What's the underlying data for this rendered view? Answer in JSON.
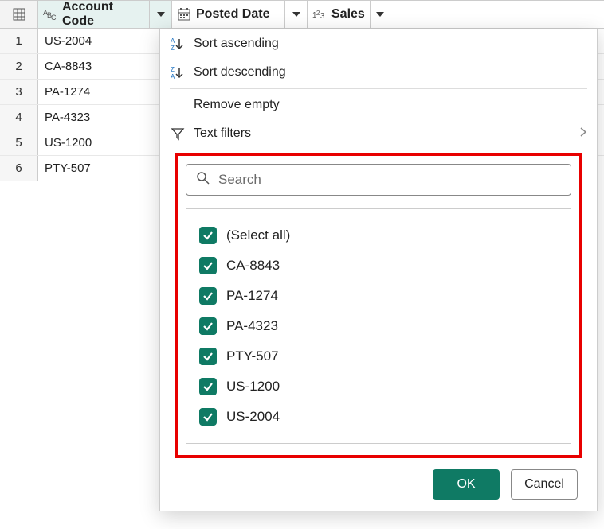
{
  "columns": [
    {
      "label": "Account Code",
      "type_icon": "text"
    },
    {
      "label": "Posted Date",
      "type_icon": "date"
    },
    {
      "label": "Sales",
      "type_icon": "number"
    }
  ],
  "rows": [
    {
      "n": "1",
      "c1": "US-2004"
    },
    {
      "n": "2",
      "c1": "CA-8843"
    },
    {
      "n": "3",
      "c1": "PA-1274"
    },
    {
      "n": "4",
      "c1": "PA-4323"
    },
    {
      "n": "5",
      "c1": "US-1200"
    },
    {
      "n": "6",
      "c1": "PTY-507"
    }
  ],
  "menu": {
    "sort_asc": "Sort ascending",
    "sort_desc": "Sort descending",
    "remove_empty": "Remove empty",
    "text_filters": "Text filters"
  },
  "search": {
    "placeholder": "Search"
  },
  "filter_options": [
    "(Select all)",
    "CA-8843",
    "PA-1274",
    "PA-4323",
    "PTY-507",
    "US-1200",
    "US-2004"
  ],
  "buttons": {
    "ok": "OK",
    "cancel": "Cancel"
  },
  "colors": {
    "accent": "#0f7a64",
    "highlight": "#e80000"
  }
}
